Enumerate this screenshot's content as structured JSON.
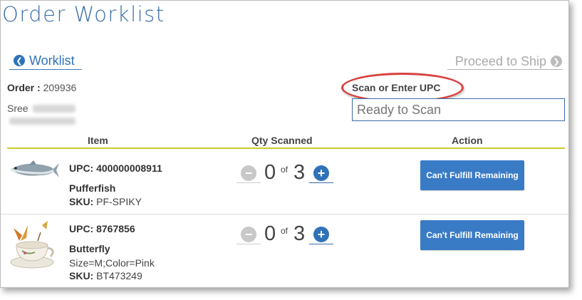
{
  "page": {
    "title": "Order Worklist"
  },
  "nav": {
    "back_label": "Worklist",
    "proceed_label": "Proceed to Ship"
  },
  "order": {
    "label": "Order :",
    "number": "209936",
    "customer_first": "Sree"
  },
  "scan": {
    "label": "Scan or Enter UPC",
    "placeholder": "Ready to Scan"
  },
  "table": {
    "headers": [
      "Item",
      "Qty Scanned",
      "Action"
    ],
    "rows": [
      {
        "upc": "UPC: 400000008911",
        "name": "Pufferfish",
        "attributes": "",
        "sku_label": "SKU:",
        "sku": "PF-SPIKY",
        "qty_scanned": "0",
        "qty_of": "of",
        "qty_total": "3",
        "action_label": "Can't Fulfill Remaining",
        "image_icon": "fish-image"
      },
      {
        "upc": "UPC: 8767856",
        "name": "Butterfly",
        "attributes": "Size=M;Color=Pink",
        "sku_label": "SKU:",
        "sku": "BT473249",
        "qty_scanned": "0",
        "qty_of": "of",
        "qty_total": "3",
        "action_label": "Can't Fulfill Remaining",
        "image_icon": "teacup-butterfly-image"
      }
    ]
  },
  "colors": {
    "primary": "#2f72b8",
    "button": "#3a7bc6",
    "highlight_oval": "#d9413f",
    "header_rule": "#c8cd2a",
    "disabled": "#c8c8c8"
  }
}
